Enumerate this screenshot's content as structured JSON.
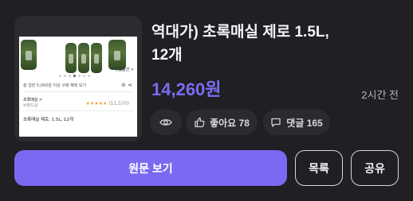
{
  "product": {
    "title_line1": "역대가) 초록매실 제로 1.5L,",
    "title_line2": "12개",
    "price": "14,260원",
    "posted_ago": "2시간 전"
  },
  "thumbnail": {
    "shipping_text": "총 일반 5,000원 이상 구매 혜택 보기",
    "brand_name": "초록매실 >",
    "brand_sub": "브랜드샵",
    "rating_count": "(11,570)",
    "product_caption": "초록매실 제로, 1.5L, 12개",
    "badge_text": "맞춤옵션 >"
  },
  "stats": {
    "views_icon": "eye-icon",
    "likes_label": "좋아요 78",
    "comments_label": "댓글 165"
  },
  "actions": {
    "open_original": "원문 보기",
    "list": "목록",
    "share": "공유"
  },
  "colors": {
    "accent": "#7a69f1",
    "price": "#7c6cf0",
    "background": "#1f1f24"
  }
}
